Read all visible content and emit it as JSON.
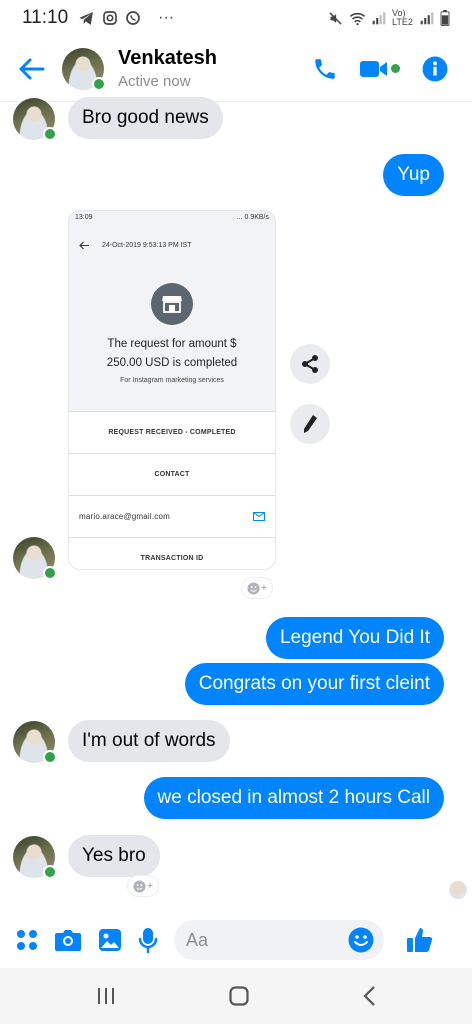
{
  "status_bar": {
    "time": "11:10",
    "dots": "···",
    "carrier": "Vo) LTE2"
  },
  "header": {
    "name": "Venkatesh",
    "status": "Active now"
  },
  "messages": {
    "m1": "Bro good news",
    "m2": "Yup",
    "m3": "Legend You Did It",
    "m4": "Congrats on your first cleint",
    "m5": "I'm out of words",
    "m6": "we closed in almost 2 hours Call",
    "m7": "Yes bro"
  },
  "screenshot": {
    "status_time": "13:09",
    "status_info": "... 0.9KB/s",
    "datetime": "24-Oct-2019 9:53:13 PM IST",
    "line1": "The request for amount $",
    "line2": "250.00 USD is completed",
    "line3": "For Instagram marketing services",
    "row1": "REQUEST RECEIVED - COMPLETED",
    "row2": "CONTACT",
    "email": "mario.arace@gmail.com",
    "row4": "TRANSACTION ID"
  },
  "composer": {
    "placeholder": "Aa"
  },
  "colors": {
    "accent": "#0084ff",
    "incoming": "#e4e6eb",
    "online": "#31a24c"
  }
}
